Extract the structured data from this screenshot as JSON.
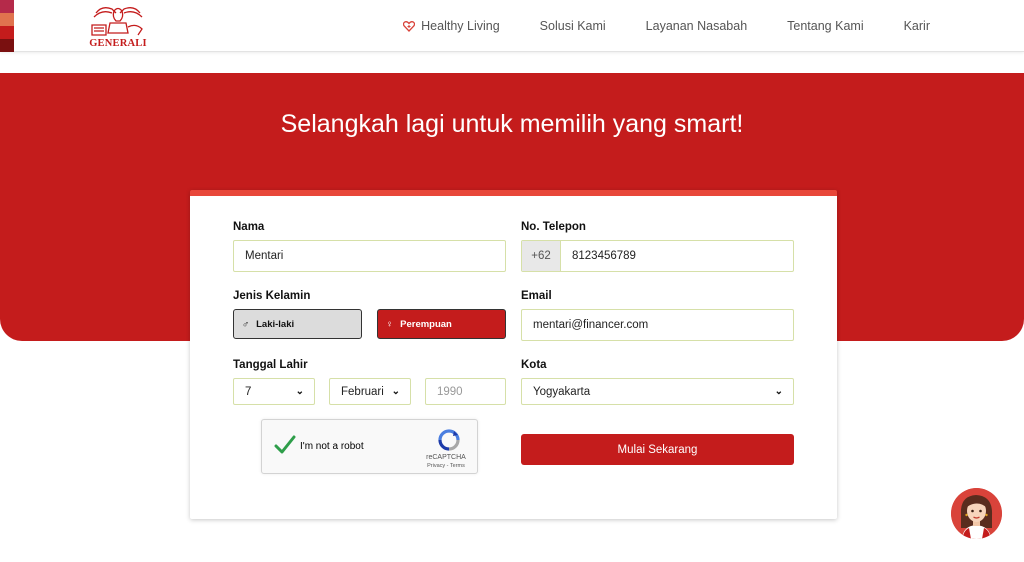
{
  "brand": {
    "name": "GENERALI",
    "color": "#c41c1c",
    "edge_colors": [
      "#b52a4a",
      "#e0734e",
      "#c41c1c",
      "#7a1010"
    ]
  },
  "nav": {
    "items": [
      {
        "label": "Healthy Living",
        "icon": "heart-leaf-icon"
      },
      {
        "label": "Solusi Kami"
      },
      {
        "label": "Layanan Nasabah"
      },
      {
        "label": "Tentang Kami"
      },
      {
        "label": "Karir"
      }
    ]
  },
  "hero": {
    "title": "Selangkah lagi untuk memilih yang smart!",
    "background": "#c41c1c"
  },
  "form": {
    "accent": "#e8473a",
    "name": {
      "label": "Nama",
      "value": "Mentari"
    },
    "phone": {
      "label": "No. Telepon",
      "prefix": "+62",
      "value": "8123456789"
    },
    "gender": {
      "label": "Jenis Kelamin",
      "male": {
        "label": "Laki-laki",
        "icon": "male-symbol-icon",
        "selected": false
      },
      "female": {
        "label": "Perempuan",
        "icon": "female-symbol-icon",
        "selected": true
      }
    },
    "email": {
      "label": "Email",
      "value": "mentari@financer.com"
    },
    "birthdate": {
      "label": "Tanggal Lahir",
      "day": "7",
      "month": "Februari",
      "year_placeholder": "1990"
    },
    "city": {
      "label": "Kota",
      "value": "Yogyakarta"
    },
    "captcha": {
      "label": "I'm not a robot",
      "checked": true,
      "brand": "reCAPTCHA",
      "links": "Privacy - Terms"
    },
    "submit_label": "Mulai Sekarang"
  },
  "chat": {
    "icon": "assistant-avatar-icon"
  }
}
